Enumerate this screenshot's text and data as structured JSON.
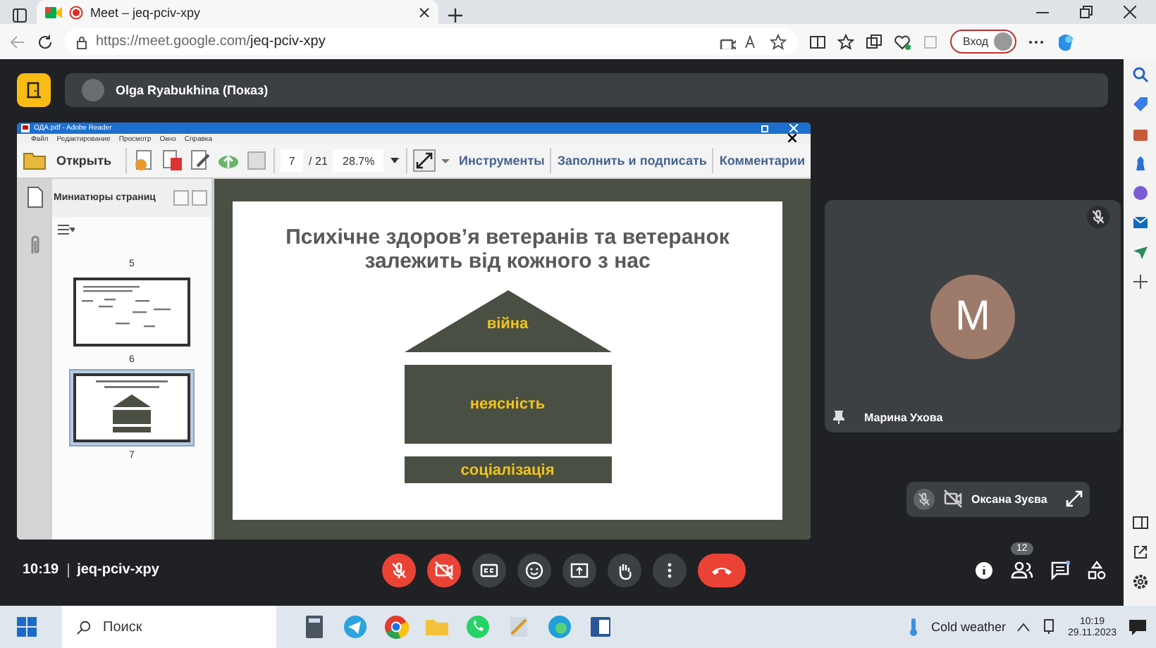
{
  "browser": {
    "tab_title": "Meet – jeq-pciv-xpy",
    "url_host": "https://meet.google.com/",
    "url_path": "jeq-pciv-xpy",
    "signin_button": "Вход"
  },
  "presenter": {
    "label": "Olga Ryabukhina (Показ)"
  },
  "reader": {
    "title": "ОДА.pdf - Adobe Reader",
    "menu": [
      "Файл",
      "Редактирование",
      "Просмотр",
      "Окно",
      "Справка"
    ],
    "open_button": "Открыть",
    "page": "7",
    "page_total": "/ 21",
    "zoom": "28.7%",
    "links": [
      "Инструменты",
      "Заполнить и подписать",
      "Комментарии"
    ],
    "panel_title": "Миниатюры страниц",
    "thumbnails": [
      {
        "number": "5",
        "kind": "none",
        "selected": false
      },
      {
        "number": "6",
        "kind": "words",
        "selected": false
      },
      {
        "number": "7",
        "kind": "house",
        "selected": true
      }
    ],
    "slide": {
      "title": "Психічне здоров’я ветеранів та ветеранок залежить від кожного з нас",
      "roof": "війна",
      "body": "неясність",
      "base": "соціалізація"
    }
  },
  "participant": {
    "initial": "M",
    "name": "Марина Ухова",
    "muted": true
  },
  "self_view": {
    "name": "Оксана Зуєва",
    "muted": true,
    "camera_off": true
  },
  "bottom_bar": {
    "time": "10:19",
    "meeting_code": "jeq-pciv-xpy",
    "mic_on": false,
    "camera_on": false,
    "people_count": "12"
  },
  "taskbar": {
    "search_placeholder": "Поиск",
    "weather": "Cold weather",
    "time": "10:19",
    "date": "29.11.2023"
  }
}
